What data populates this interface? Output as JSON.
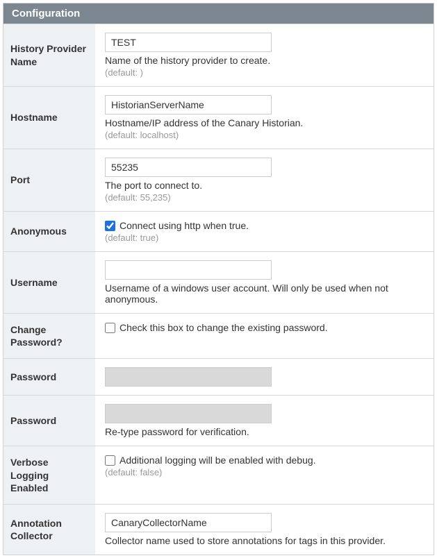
{
  "panel": {
    "title": "Configuration"
  },
  "fields": {
    "historyProvider": {
      "label": "History Provider Name",
      "value": "TEST",
      "desc": "Name of the history provider to create.",
      "default": "(default: )"
    },
    "hostname": {
      "label": "Hostname",
      "value": "HistorianServerName",
      "desc": "Hostname/IP address of the Canary Historian.",
      "default": "(default: localhost)"
    },
    "port": {
      "label": "Port",
      "value": "55235",
      "desc": "The port to connect to.",
      "default": "(default: 55,235)"
    },
    "anonymous": {
      "label": "Anonymous",
      "checked": true,
      "text": "Connect using http when true.",
      "default": "(default: true)"
    },
    "username": {
      "label": "Username",
      "value": "",
      "desc": "Username of a windows user account. Will only be used when not anonymous."
    },
    "changePassword": {
      "label": "Change Password?",
      "checked": false,
      "text": "Check this box to change the existing password."
    },
    "password1": {
      "label": "Password",
      "value": "",
      "disabled": true
    },
    "password2": {
      "label": "Password",
      "value": "",
      "disabled": true,
      "desc": "Re-type password for verification."
    },
    "verbose": {
      "label": "Verbose Logging Enabled",
      "checked": false,
      "text": "Additional logging will be enabled with debug.",
      "default": "(default: false)"
    },
    "annotationCollector": {
      "label": "Annotation Collector",
      "value": "CanaryCollectorName",
      "desc": "Collector name used to store annotations for tags in this provider."
    }
  }
}
